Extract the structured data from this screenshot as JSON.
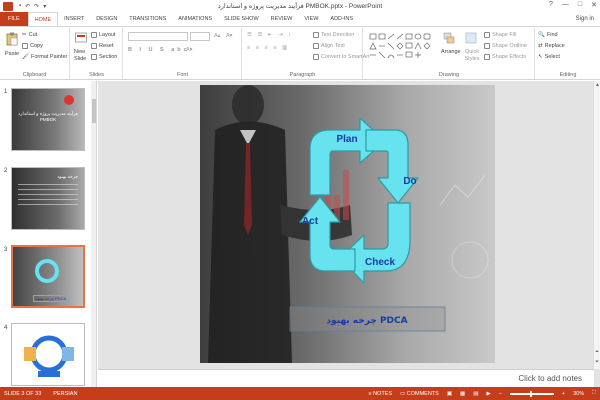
{
  "window": {
    "title": "فرآیند مدیریت پروژه و استاندارد PMBOK.pptx - PowerPoint",
    "controls": [
      "?",
      "—",
      "□",
      "✕"
    ]
  },
  "ribbon_tabs": [
    "FILE",
    "HOME",
    "INSERT",
    "DESIGN",
    "TRANSITIONS",
    "ANIMATIONS",
    "SLIDE SHOW",
    "REVIEW",
    "VIEW",
    "ADD-INS"
  ],
  "account": {
    "signin": "Sign in"
  },
  "clipboard": {
    "paste": "Paste",
    "cut": "Cut",
    "copy": "Copy",
    "format_painter": "Format Painter",
    "label": "Clipboard"
  },
  "slides_group": {
    "new_slide": "New Slide",
    "layout": "Layout",
    "reset": "Reset",
    "section": "Section",
    "label": "Slides"
  },
  "font_group": {
    "label": "Font"
  },
  "paragraph_group": {
    "text_direction": "Text Direction",
    "align_text": "Align Text",
    "convert_smartart": "Convert to SmartArt",
    "label": "Paragraph"
  },
  "drawing_group": {
    "arrange": "Arrange",
    "quick_styles": "Quick Styles",
    "shape_fill": "Shape Fill",
    "shape_outline": "Shape Outline",
    "shape_effects": "Shape Effects",
    "label": "Drawing"
  },
  "editing_group": {
    "find": "Find",
    "replace": "Replace",
    "select": "Select",
    "label": "Editing"
  },
  "thumbnails": [
    {
      "number": "1",
      "title": "فرآیند مدیریت پروژه و استاندارد PMBOK"
    },
    {
      "number": "2",
      "title": "چرخه بهبود"
    },
    {
      "number": "3",
      "caption": "چرخه بهبود PDCA"
    },
    {
      "number": "4"
    }
  ],
  "slide": {
    "cycle_labels": {
      "plan": "Plan",
      "do": "Do",
      "check": "Check",
      "act": "Act"
    },
    "caption": "چرخه بهبود PDCA"
  },
  "notes_placeholder": "Click to add notes",
  "status": {
    "slide_info": "SLIDE 3 OF 33",
    "language": "PERSIAN",
    "notes": "NOTES",
    "comments": "COMMENTS",
    "zoom": "30%"
  },
  "colors": {
    "accent": "#c43e1c",
    "arrow_fill": "#66e3ee",
    "cycle_label": "#1a3aa8",
    "selection": "#e8724b"
  }
}
